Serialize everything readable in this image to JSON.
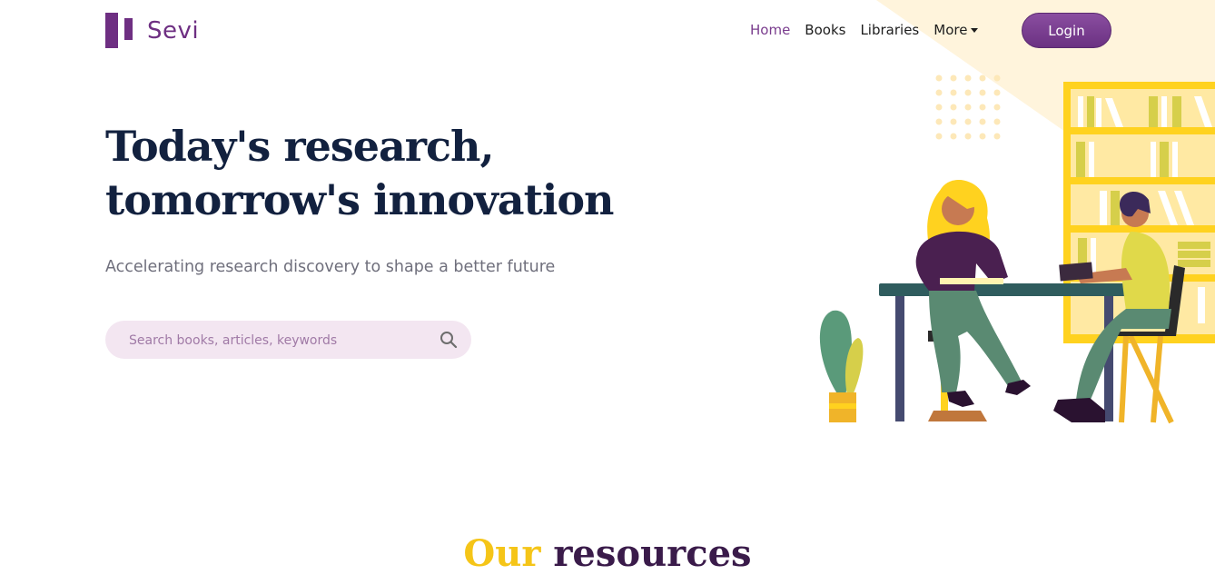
{
  "brand": {
    "name": "Sevi",
    "logo_icon": "logo-mark",
    "color": "#6e2f82"
  },
  "nav": {
    "items": [
      {
        "label": "Home",
        "active": true
      },
      {
        "label": "Books",
        "active": false
      },
      {
        "label": "Libraries",
        "active": false
      },
      {
        "label": "More",
        "active": false,
        "dropdown": true
      }
    ],
    "login_label": "Login"
  },
  "hero": {
    "title_line1": "Today's research,",
    "title_line2": "tomorrow's innovation",
    "subtitle": "Accelerating research discovery to shape a better future",
    "search": {
      "placeholder": "Search books, articles, keywords",
      "value": "",
      "icon": "search-icon"
    }
  },
  "resources": {
    "title_accent": "Our",
    "title_rest": "resources"
  },
  "colors": {
    "primary": "#6e2f82",
    "title": "#12213f",
    "accent_yellow": "#f5c518",
    "search_bg": "#f3e6f1",
    "bg_triangle": "#fff4dc"
  }
}
